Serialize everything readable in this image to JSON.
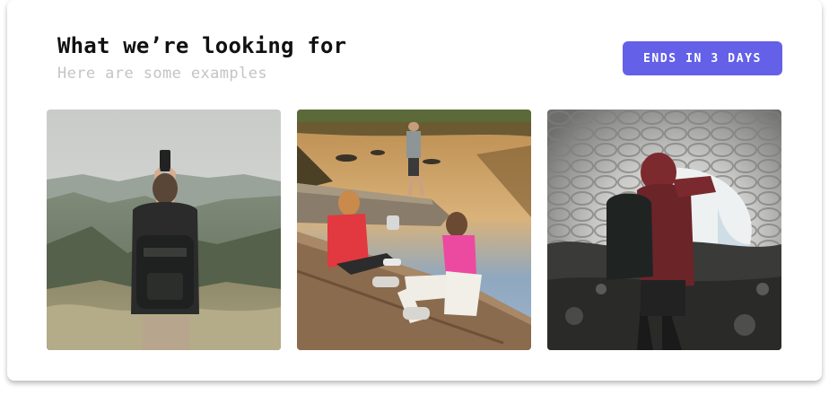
{
  "header": {
    "title": "What we’re looking for",
    "subtitle": "Here are some examples"
  },
  "badge": {
    "label": "ENDS IN 3 DAYS",
    "color": "#6461e8"
  },
  "examples": [
    {
      "icon": "hiker-phone-mountains-photo"
    },
    {
      "icon": "friends-on-log-by-lake-photo"
    },
    {
      "icon": "person-in-ice-cave-photo"
    }
  ]
}
